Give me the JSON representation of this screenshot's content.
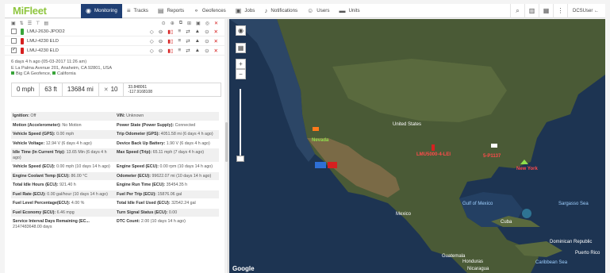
{
  "app": {
    "logo": "MiFleet",
    "user": "DCSUser ←"
  },
  "nav": [
    {
      "label": "Monitoring",
      "icon": "globe-icon",
      "glyph": "◉"
    },
    {
      "label": "Tracks",
      "icon": "tracks-icon",
      "glyph": "≡"
    },
    {
      "label": "Reports",
      "icon": "reports-icon",
      "glyph": "▤"
    },
    {
      "label": "Geofences",
      "icon": "geofence-icon",
      "glyph": "⚬"
    },
    {
      "label": "Jobs",
      "icon": "jobs-icon",
      "glyph": "▣"
    },
    {
      "label": "Notifications",
      "icon": "bell-icon",
      "glyph": "♪"
    },
    {
      "label": "Users",
      "icon": "users-icon",
      "glyph": "☺"
    },
    {
      "label": "Units",
      "icon": "car-icon",
      "glyph": "▬"
    }
  ],
  "nav_right": {
    "search": "⌕",
    "chart": "▥",
    "grid": "▦",
    "more": "⋮"
  },
  "assets": [
    {
      "name": "LMU-2630-JPOD2",
      "checked": false
    },
    {
      "name": "LMU-4230 ELD",
      "checked": false
    },
    {
      "name": "LMU-4230 ELD",
      "checked": true
    }
  ],
  "detail": {
    "time": "6 days 4 h ago (05-03-2017 11:26 am)",
    "address": "E La Palma Avenue 201, Anaheim, CA 92801, USA",
    "geofences": [
      "Big CA Geofence,",
      "California"
    ],
    "speed": "0 mph",
    "altitude": "63 ft",
    "odometer": "13684 mi",
    "satellites": "10",
    "lat": "33.848061",
    "lng": "-117.9168108"
  },
  "grid": [
    [
      {
        "label": "Ignition:",
        "value": "Off"
      },
      {
        "label": "VIN:",
        "value": "Unknown"
      }
    ],
    [
      {
        "label": "Motion (Accelerometer):",
        "value": "No Motion"
      },
      {
        "label": "Power State (Power Supply):",
        "value": "Connected"
      }
    ],
    [
      {
        "label": "Vehicle Speed (GPS):",
        "value": "0.00 mph"
      },
      {
        "label": "Trip Odometer (GPS):",
        "value": "4051.58 mi (6 days 4 h ago)"
      }
    ],
    [
      {
        "label": "Vehicle Voltage:",
        "value": "12.94 V (6 days 4 h ago)"
      },
      {
        "label": "Device Back Up Battery:",
        "value": "1.90 V (6 days 4 h ago)"
      }
    ],
    [
      {
        "label": "Idle Time (In Current Trip):",
        "value": "13.65 Min (6 days 4 h ago)"
      },
      {
        "label": "Max Speed (Trip):",
        "value": "65.11 mph (7 days 4 h ago)"
      }
    ],
    [
      {
        "label": "Vehicle Speed (ECU):",
        "value": "0.00 mph (10 days 14 h ago)"
      },
      {
        "label": "Engine Speed (ECU):",
        "value": "0.00 rpm (10 days 14 h ago)"
      }
    ],
    [
      {
        "label": "Engine Coolant Temp (ECU):",
        "value": "86.00 °C"
      },
      {
        "label": "Odometer (ECU):",
        "value": "99622.07 mi (10 days 14 h ago)"
      }
    ],
    [
      {
        "label": "Total Idle Hours (ECU):",
        "value": "921.40 h"
      },
      {
        "label": "Engine Run Time (ECU):",
        "value": "35454.35 h"
      }
    ],
    [
      {
        "label": "Fuel Rate (ECU):",
        "value": "0.00 gal/hour (10 days 14 h ago)"
      },
      {
        "label": "Fuel Per Trip (ECU):",
        "value": "15876.06 gal"
      }
    ],
    [
      {
        "label": "Fuel Level Percentage(ECU):",
        "value": "4.00 %"
      },
      {
        "label": "Total Idle Fuel Used (ECU):",
        "value": "32542.24 gal"
      }
    ],
    [
      {
        "label": "Fuel Economy (ECU):",
        "value": "6.46 mpg"
      },
      {
        "label": "Turn Signal Status (ECU):",
        "value": "0.00"
      }
    ],
    [
      {
        "label": "Service Interval Days Remaining (EC...",
        "value": "2147483648.00 days"
      },
      {
        "label": "DTC Count:",
        "value": "2.00 (10 days 14 h ago)"
      }
    ]
  ],
  "map": {
    "labels": {
      "us": "United States",
      "mexico": "Mexico",
      "cuba": "Cuba",
      "gulf": "Gulf of Mexico",
      "sargasso": "Sargasso Sea",
      "caribbean": "Caribbean Sea",
      "dominican": "Dominican Republic",
      "guatemala": "Guatemala",
      "honduras": "Honduras",
      "nicaragua": "Nicaragua",
      "puerto": "Puerto Rico",
      "nevada": "Nevada",
      "new_york": "New York",
      "unit_red_1": "LMU5000-4-LEI",
      "unit_red_2": "5-P1137",
      "google": "Google"
    }
  }
}
